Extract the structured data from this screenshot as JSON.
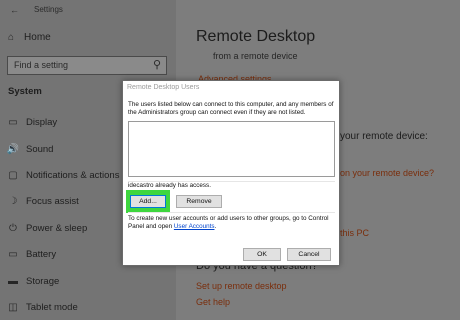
{
  "window": {
    "title": "Settings"
  },
  "sidebar": {
    "home": "Home",
    "search_placeholder": "Find a setting",
    "section": "System",
    "items": [
      {
        "label": "Display",
        "icon": "monitor-icon"
      },
      {
        "label": "Sound",
        "icon": "speaker-icon"
      },
      {
        "label": "Notifications & actions",
        "icon": "notification-icon"
      },
      {
        "label": "Focus assist",
        "icon": "moon-icon"
      },
      {
        "label": "Power & sleep",
        "icon": "power-icon"
      },
      {
        "label": "Battery",
        "icon": "battery-icon"
      },
      {
        "label": "Storage",
        "icon": "storage-icon"
      },
      {
        "label": "Tablet mode",
        "icon": "tablet-icon"
      }
    ]
  },
  "main": {
    "title": "Remote Desktop",
    "subtitle": "from a remote device",
    "link_advanced": "Advanced settings",
    "partial_device": "your remote device:",
    "partial_link": "on your remote device?",
    "partial_pc": "this PC",
    "question": "Do you have a question?",
    "link_setup": "Set up remote desktop",
    "link_help": "Get help"
  },
  "dialog": {
    "title": "Remote Desktop Users",
    "description": "The users listed below can connect to this computer, and any members of the Administrators group can connect even if they are not listed.",
    "access_text": "idecastro already has access.",
    "add_label": "Add...",
    "remove_label": "Remove",
    "note_prefix": "To create new user accounts or add users to other groups, go to Control Panel and open ",
    "note_link": "User Accounts",
    "note_suffix": ".",
    "ok_label": "OK",
    "cancel_label": "Cancel"
  },
  "colors": {
    "highlight": "#3ed63e",
    "link": "#0044cc"
  }
}
